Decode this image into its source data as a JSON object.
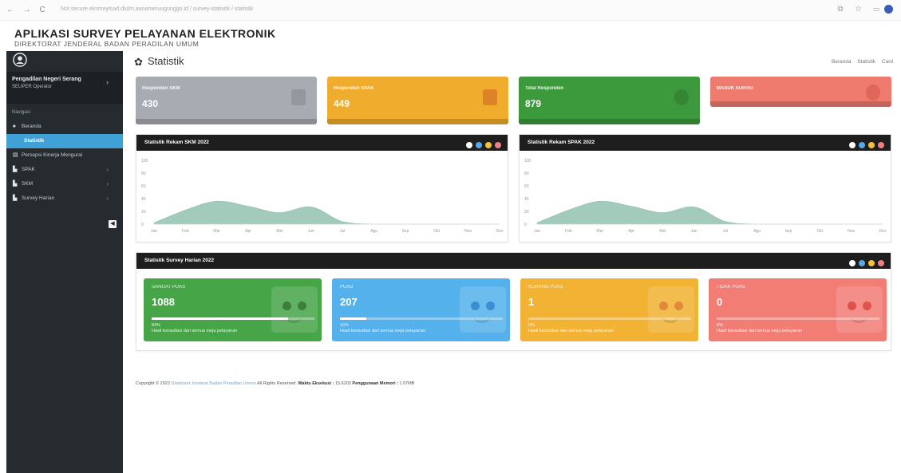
{
  "browser": {
    "nav": "← → C",
    "url": "Not secure  eksmeytsad.dlulm.aanameruugunggo.id / survey-statistik / statistik",
    "icons": "⧉ ☆ ▭"
  },
  "header": {
    "title": "APLIKASI SURVEY PELAYANAN ELEKTRONIK",
    "subtitle": "DIREKTORAT JENDERAL BADAN PERADILAN UMUM"
  },
  "sidebar": {
    "user_name": "Pengadilan Negeri Serang",
    "user_role": "SEUPER Operator",
    "section_label": "Navigasi",
    "toggle": "◀",
    "items": [
      {
        "label": "Beranda",
        "icon": "home-icon",
        "glyph": "♠",
        "chevron": ""
      },
      {
        "label": "Statistik",
        "icon": "",
        "glyph": "",
        "chevron": ""
      },
      {
        "label": "Persepsi Kinerja Mengurai",
        "icon": "document-icon",
        "glyph": "▤",
        "chevron": ""
      },
      {
        "label": "SPAK",
        "icon": "file-icon",
        "glyph": "▙",
        "chevron": "›"
      },
      {
        "label": "SKM",
        "icon": "file-icon",
        "glyph": "▙",
        "chevron": "›"
      },
      {
        "label": "Survey Harian",
        "icon": "file-icon",
        "glyph": "▙",
        "chevron": "›"
      }
    ]
  },
  "page": {
    "title": "Statistik",
    "breadcrumb": [
      "Beranda",
      "Statistik",
      "Card"
    ]
  },
  "stats": [
    {
      "label": "Responden SKM",
      "value": "430",
      "color": "#a9abb3"
    },
    {
      "label": "Responden SPAK",
      "value": "449",
      "color": "#f0ac2c"
    },
    {
      "label": "Total Responden",
      "value": "879",
      "color": "#3c9a3c"
    },
    {
      "label": "MASUK SURVEI",
      "value": "",
      "color": "#ef7b6e"
    }
  ],
  "chart_panels": [
    {
      "title": "Statistik Rekam SKM 2022"
    },
    {
      "title": "Statistik Rekam SPAK 2022"
    }
  ],
  "chart_data": [
    {
      "type": "area",
      "title": "Statistik Rekam SKM 2022",
      "categories": [
        "Jan",
        "Feb",
        "Mar",
        "Apr",
        "Mei",
        "Jun",
        "Jul",
        "Agu",
        "Sep",
        "Okt",
        "Nov",
        "Des"
      ],
      "values": [
        2,
        22,
        36,
        28,
        18,
        27,
        4,
        0,
        0,
        0,
        0,
        0
      ],
      "y_ticks": [
        "0",
        "20",
        "40",
        "60",
        "80",
        "100"
      ],
      "ylim": [
        0,
        100
      ],
      "color": "#a3cbbc"
    },
    {
      "type": "area",
      "title": "Statistik Rekam SPAK 2022",
      "categories": [
        "Jan",
        "Feb",
        "Mar",
        "Apr",
        "Mei",
        "Jun",
        "Jul",
        "Agu",
        "Sep",
        "Okt",
        "Nov",
        "Des"
      ],
      "values": [
        2,
        22,
        36,
        28,
        18,
        27,
        4,
        0,
        0,
        0,
        0,
        0
      ],
      "y_ticks": [
        "0",
        "20",
        "40",
        "60",
        "80",
        "100"
      ],
      "ylim": [
        0,
        100
      ],
      "color": "#a3cbbc"
    }
  ],
  "survey": {
    "title": "Statistik Survey Harian 2022",
    "cards": [
      {
        "label": "SANGAT PUAS",
        "value": "1088",
        "percent": 84,
        "percent_text": "84%",
        "desc": "Hasil konsultasi dari semua meja pelayanan",
        "color": "#46a547",
        "eye_color": "#3c7f3a"
      },
      {
        "label": "PUAS",
        "value": "207",
        "percent": 16,
        "percent_text": "16%",
        "desc": "Hasil konsultasi dari semua meja pelayanan",
        "color": "#54b1ec",
        "eye_color": "#3a8fd2"
      },
      {
        "label": "KURANG PUAS",
        "value": "1",
        "percent": 0,
        "percent_text": "0%",
        "desc": "Hasil konsultasi dari semua meja pelayanan",
        "color": "#f2b233",
        "eye_color": "#e08a3a"
      },
      {
        "label": "TIDAK PUAS",
        "value": "0",
        "percent": 0,
        "percent_text": "0%",
        "desc": "Hasil konsultasi dari semua meja pelayanan",
        "color": "#f17d75",
        "eye_color": "#e0524c"
      }
    ]
  },
  "panel_dots": [
    "#ffffff",
    "#5aa9e6",
    "#f4c236",
    "#ef7f82"
  ],
  "footer": {
    "prefix": "Copyright © 2022",
    "link": "Direktorat Jenderal Badan Peradilan Umum",
    "rights": "All Rights Reserved.",
    "exec_label": "Waktu Eksekusi :",
    "exec_value": "15.6203",
    "mem_label": "Penggunaan Memori :",
    "mem_value": "1.07MB"
  }
}
